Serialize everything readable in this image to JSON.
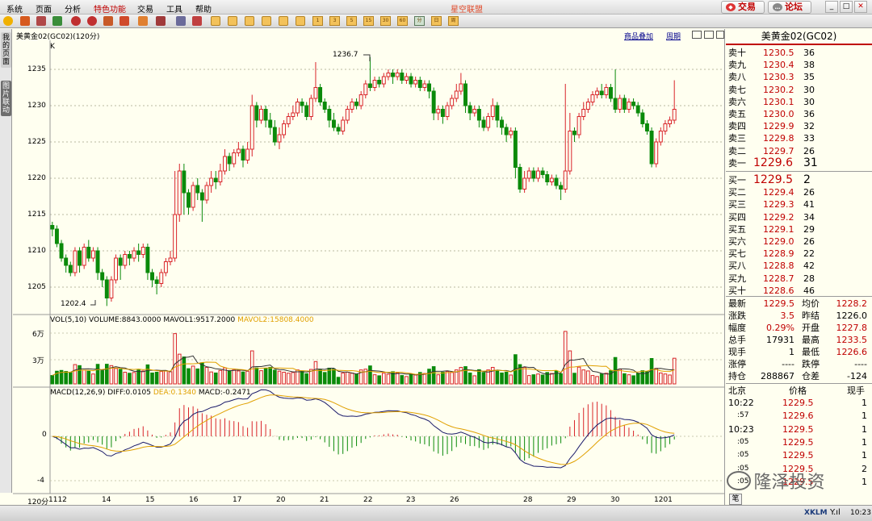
{
  "menu": {
    "items": [
      "系统",
      "页面",
      "分析",
      "特色功能",
      "交易",
      "工具",
      "帮助"
    ],
    "title": "星空联盟",
    "trade_btn": "交易",
    "forum_btn": "论坛"
  },
  "toolbar": {
    "periods": [
      "1",
      "3",
      "5",
      "15",
      "30",
      "60",
      "分",
      "日",
      "周"
    ]
  },
  "sidebar": {
    "tab1": "我的页面",
    "tab2": "图片联动"
  },
  "chart": {
    "header": "美黄金02(GC02)(120分)",
    "k_label": "K",
    "link_overlay": "商品叠加",
    "link_period": "周期",
    "price_ticks": [
      "1235",
      "1230",
      "1225",
      "1220",
      "1215",
      "1210",
      "1205"
    ],
    "high_label": "1236.7",
    "low_label": "1202.4",
    "vol_header": {
      "name": "VOL(5,10)",
      "volume": "VOLUME:8843.0000",
      "mavol1": "MAVOL1:9517.2000",
      "mavol2": "MAVOL2:15808.4000"
    },
    "vol_ticks": [
      "6万",
      "3万"
    ],
    "macd_header": {
      "name": "MACD(12,26,9)",
      "diff": "DIFF:0.0105",
      "dea": "DEA:0.1340",
      "macd": "MACD:-0.2471"
    },
    "macd_ticks": [
      "0",
      "-4"
    ],
    "x_axis": {
      "period": "120分",
      "labels": [
        "1112",
        "14",
        "15",
        "16",
        "17",
        "20",
        "21",
        "22",
        "23",
        "26",
        "28",
        "29",
        "30",
        "1201"
      ]
    }
  },
  "chart_data": {
    "type": "candlestick",
    "timeframe": "120分",
    "ylim": [
      1200,
      1238
    ],
    "y_ticks": [
      1205,
      1210,
      1215,
      1220,
      1225,
      1230,
      1235
    ],
    "high_marker": 1236.7,
    "low_marker": 1202.4,
    "candles": [
      [
        1213.5,
        1213,
        1214,
        1212
      ],
      [
        1213,
        1211,
        1213.5,
        1210.5
      ],
      [
        1211,
        1209,
        1211.5,
        1208.5
      ],
      [
        1209,
        1208,
        1209.5,
        1207
      ],
      [
        1208,
        1207,
        1208.5,
        1206.5
      ],
      [
        1207,
        1210,
        1210.5,
        1206.5
      ],
      [
        1210,
        1208,
        1210.5,
        1207
      ],
      [
        1208,
        1210.5,
        1211,
        1207.5
      ],
      [
        1210.5,
        1209,
        1211.5,
        1208.5
      ],
      [
        1209,
        1210,
        1210.5,
        1208.5
      ],
      [
        1210,
        1207,
        1210.5,
        1206
      ],
      [
        1207,
        1206,
        1207.5,
        1205
      ],
      [
        1206,
        1203.5,
        1206.5,
        1202.4
      ],
      [
        1203.5,
        1206,
        1206.5,
        1203
      ],
      [
        1206,
        1209,
        1209.5,
        1205.5
      ],
      [
        1209,
        1208,
        1209.5,
        1206
      ],
      [
        1208,
        1209.5,
        1210,
        1207.5
      ],
      [
        1209.5,
        1209,
        1210,
        1208
      ],
      [
        1209,
        1210,
        1210.5,
        1208.5
      ],
      [
        1210,
        1209.5,
        1211,
        1208.5
      ],
      [
        1209.5,
        1210.5,
        1211,
        1209
      ],
      [
        1210.5,
        1207,
        1211,
        1206
      ],
      [
        1207,
        1206,
        1207.5,
        1205
      ],
      [
        1206,
        1205.5,
        1206.5,
        1204
      ],
      [
        1205.5,
        1207,
        1207.5,
        1205
      ],
      [
        1207,
        1208.5,
        1209,
        1206.5
      ],
      [
        1208.5,
        1209,
        1210,
        1208
      ],
      [
        1209,
        1215,
        1221,
        1208.5
      ],
      [
        1215,
        1221,
        1222,
        1214
      ],
      [
        1221,
        1218,
        1222,
        1215
      ],
      [
        1218,
        1216,
        1218.5,
        1215
      ],
      [
        1216,
        1219,
        1219.5,
        1215.5
      ],
      [
        1219,
        1218,
        1220,
        1217
      ],
      [
        1218,
        1217,
        1218.5,
        1214
      ],
      [
        1217,
        1219,
        1219.5,
        1216.5
      ],
      [
        1219,
        1220,
        1221,
        1218
      ],
      [
        1220,
        1219.5,
        1221,
        1218.5
      ],
      [
        1219.5,
        1221,
        1222,
        1219
      ],
      [
        1221,
        1223,
        1224,
        1220.5
      ],
      [
        1223,
        1222,
        1223.5,
        1221
      ],
      [
        1222,
        1223.5,
        1224,
        1221.5
      ],
      [
        1223.5,
        1224,
        1225,
        1223
      ],
      [
        1224,
        1222.5,
        1224.5,
        1221.5
      ],
      [
        1222.5,
        1224,
        1225,
        1222
      ],
      [
        1224,
        1230,
        1231.5,
        1223
      ],
      [
        1230,
        1228,
        1230.5,
        1227
      ],
      [
        1228,
        1229.5,
        1230,
        1227.5
      ],
      [
        1229.5,
        1228,
        1230,
        1227
      ],
      [
        1228,
        1227,
        1229,
        1226
      ],
      [
        1227,
        1225,
        1228,
        1224.5
      ],
      [
        1225,
        1226,
        1227,
        1224
      ],
      [
        1226,
        1227.5,
        1228,
        1225.5
      ],
      [
        1227.5,
        1228.5,
        1229,
        1227
      ],
      [
        1228.5,
        1229,
        1230,
        1228
      ],
      [
        1229,
        1230.5,
        1231,
        1228.5
      ],
      [
        1230.5,
        1230,
        1231,
        1229
      ],
      [
        1230,
        1228.5,
        1230.5,
        1228
      ],
      [
        1228.5,
        1231,
        1231.5,
        1228
      ],
      [
        1231,
        1232.5,
        1236,
        1230.5
      ],
      [
        1232.5,
        1230.5,
        1233,
        1230
      ],
      [
        1230.5,
        1229.5,
        1231,
        1229
      ],
      [
        1229.5,
        1228,
        1230,
        1227
      ],
      [
        1228,
        1227,
        1229,
        1226.5
      ],
      [
        1227,
        1226.5,
        1227.5,
        1226
      ],
      [
        1226.5,
        1228,
        1228.5,
        1226
      ],
      [
        1228,
        1229.5,
        1230,
        1227.5
      ],
      [
        1229.5,
        1230.5,
        1231,
        1229
      ],
      [
        1230.5,
        1230,
        1231,
        1229.5
      ],
      [
        1230,
        1231.5,
        1232,
        1229.5
      ],
      [
        1231.5,
        1233,
        1233.5,
        1231
      ],
      [
        1233,
        1232.5,
        1236.7,
        1232
      ],
      [
        1232.5,
        1233.5,
        1234,
        1232
      ],
      [
        1233.5,
        1233,
        1234,
        1232.5
      ],
      [
        1233,
        1234,
        1234.5,
        1232.5
      ],
      [
        1234,
        1234.5,
        1235,
        1233.5
      ],
      [
        1234.5,
        1234,
        1235,
        1233
      ],
      [
        1234,
        1234.5,
        1235,
        1233.5
      ],
      [
        1234.5,
        1233.5,
        1235,
        1233
      ],
      [
        1233.5,
        1234,
        1234.5,
        1233
      ],
      [
        1234,
        1233,
        1234.5,
        1232.5
      ],
      [
        1233,
        1233.5,
        1234,
        1232.5
      ],
      [
        1233.5,
        1232.5,
        1234,
        1232
      ],
      [
        1232.5,
        1233,
        1233.5,
        1232
      ],
      [
        1233,
        1232,
        1233.5,
        1231
      ],
      [
        1232,
        1229,
        1232.5,
        1228
      ],
      [
        1229,
        1229.5,
        1230,
        1228
      ],
      [
        1229.5,
        1228.5,
        1230,
        1227.5
      ],
      [
        1228.5,
        1230,
        1230.5,
        1228
      ],
      [
        1230,
        1231,
        1231.5,
        1229.5
      ],
      [
        1231,
        1232,
        1233,
        1230.5
      ],
      [
        1232,
        1233,
        1234.5,
        1231.5
      ],
      [
        1233,
        1230,
        1233.5,
        1229
      ],
      [
        1230,
        1229,
        1230.5,
        1228
      ],
      [
        1229,
        1229.5,
        1230,
        1228.5
      ],
      [
        1229.5,
        1228,
        1230,
        1227
      ],
      [
        1228,
        1227,
        1228.5,
        1226.5
      ],
      [
        1227,
        1228.5,
        1229,
        1226.5
      ],
      [
        1228.5,
        1230,
        1231,
        1228
      ],
      [
        1230,
        1228,
        1230.5,
        1227
      ],
      [
        1228,
        1227,
        1228.5,
        1226
      ],
      [
        1227,
        1226,
        1227.5,
        1225
      ],
      [
        1226,
        1226.5,
        1227,
        1225.5
      ],
      [
        1226.5,
        1221.5,
        1227,
        1220
      ],
      [
        1221.5,
        1218.5,
        1222,
        1218
      ],
      [
        1218.5,
        1220,
        1221,
        1218
      ],
      [
        1220,
        1221,
        1221.5,
        1219.5
      ],
      [
        1221,
        1220,
        1221.5,
        1219.5
      ],
      [
        1220,
        1221,
        1221.5,
        1219.5
      ],
      [
        1221,
        1220.5,
        1221.5,
        1220
      ],
      [
        1220.5,
        1219.5,
        1221,
        1219
      ],
      [
        1219.5,
        1220,
        1220.5,
        1219
      ],
      [
        1220,
        1219,
        1220.5,
        1218.5
      ],
      [
        1219,
        1218.5,
        1219.5,
        1217
      ],
      [
        1218.5,
        1221,
        1233,
        1218
      ],
      [
        1221,
        1226.5,
        1229,
        1220.5
      ],
      [
        1226.5,
        1226,
        1227,
        1225
      ],
      [
        1226,
        1228.5,
        1229,
        1225.5
      ],
      [
        1228.5,
        1229.5,
        1230.5,
        1228
      ],
      [
        1229.5,
        1230.5,
        1231,
        1229
      ],
      [
        1230.5,
        1231.5,
        1232,
        1230
      ],
      [
        1231.5,
        1232,
        1232.5,
        1231
      ],
      [
        1232,
        1231.5,
        1233,
        1231
      ],
      [
        1231.5,
        1232.5,
        1233,
        1231
      ],
      [
        1232.5,
        1231,
        1233,
        1230.5
      ],
      [
        1231,
        1229.5,
        1235,
        1229
      ],
      [
        1229.5,
        1231,
        1231.5,
        1229
      ],
      [
        1231,
        1229.5,
        1231.5,
        1229
      ],
      [
        1229.5,
        1230.5,
        1231,
        1229
      ],
      [
        1230.5,
        1230,
        1231,
        1229.5
      ],
      [
        1230,
        1229,
        1230.5,
        1228.5
      ],
      [
        1229,
        1227.5,
        1229.5,
        1227
      ],
      [
        1227.5,
        1226.5,
        1228,
        1226
      ],
      [
        1226.5,
        1222,
        1227,
        1221.5
      ],
      [
        1222,
        1225,
        1225.5,
        1221.5
      ],
      [
        1225,
        1226.5,
        1227,
        1224.5
      ],
      [
        1226.5,
        1227.5,
        1228,
        1226
      ],
      [
        1227.5,
        1228,
        1228.5,
        1227
      ],
      [
        1228,
        1229.5,
        1233.5,
        1227.5
      ]
    ],
    "volume_ticks": [
      "6万",
      "3万"
    ],
    "volume": {
      "value": 8843.0,
      "mavol1": 9517.2,
      "mavol2": 15808.4
    },
    "macd": {
      "params": "12,26,9",
      "diff": 0.0105,
      "dea": 0.134,
      "macd": -0.2471,
      "ticks": [
        0,
        -4
      ]
    },
    "x_labels": [
      "1112",
      "14",
      "15",
      "16",
      "17",
      "20",
      "21",
      "22",
      "23",
      "26",
      "28",
      "29",
      "30",
      "1201"
    ]
  },
  "panel": {
    "title": "美黄金02(GC02)",
    "asks": [
      {
        "label": "卖十",
        "price": "1230.5",
        "vol": "36"
      },
      {
        "label": "卖九",
        "price": "1230.4",
        "vol": "38"
      },
      {
        "label": "卖八",
        "price": "1230.3",
        "vol": "35"
      },
      {
        "label": "卖七",
        "price": "1230.2",
        "vol": "30"
      },
      {
        "label": "卖六",
        "price": "1230.1",
        "vol": "30"
      },
      {
        "label": "卖五",
        "price": "1230.0",
        "vol": "36"
      },
      {
        "label": "卖四",
        "price": "1229.9",
        "vol": "32"
      },
      {
        "label": "卖三",
        "price": "1229.8",
        "vol": "33"
      },
      {
        "label": "卖二",
        "price": "1229.7",
        "vol": "26"
      },
      {
        "label": "卖一",
        "price": "1229.6",
        "vol": "31"
      }
    ],
    "bids": [
      {
        "label": "买一",
        "price": "1229.5",
        "vol": "2"
      },
      {
        "label": "买二",
        "price": "1229.4",
        "vol": "26"
      },
      {
        "label": "买三",
        "price": "1229.3",
        "vol": "41"
      },
      {
        "label": "买四",
        "price": "1229.2",
        "vol": "34"
      },
      {
        "label": "买五",
        "price": "1229.1",
        "vol": "29"
      },
      {
        "label": "买六",
        "price": "1229.0",
        "vol": "26"
      },
      {
        "label": "买七",
        "price": "1228.9",
        "vol": "22"
      },
      {
        "label": "买八",
        "price": "1228.8",
        "vol": "42"
      },
      {
        "label": "买九",
        "price": "1228.7",
        "vol": "28"
      },
      {
        "label": "买十",
        "price": "1228.6",
        "vol": "46"
      }
    ],
    "stats": [
      {
        "l1": "最新",
        "v1": "1229.5",
        "l2": "均价",
        "v2": "1228.2"
      },
      {
        "l1": "涨跌",
        "v1": "3.5",
        "l2": "昨结",
        "v2": "1226.0"
      },
      {
        "l1": "幅度",
        "v1": "0.29%",
        "l2": "开盘",
        "v2": "1227.8"
      },
      {
        "l1": "总手",
        "v1": "17931",
        "l2": "最高",
        "v2": "1233.5"
      },
      {
        "l1": "现手",
        "v1": "1",
        "l2": "最低",
        "v2": "1226.6"
      },
      {
        "l1": "涨停",
        "v1": "----",
        "l2": "跌停",
        "v2": "----"
      },
      {
        "l1": "持仓",
        "v1": "288867",
        "l2": "仓差",
        "v2": "-124"
      }
    ],
    "ticks_header": {
      "place": "北京",
      "price": "价格",
      "vol": "现手"
    },
    "ticks": [
      {
        "time": "10:22",
        "price": "1229.5",
        "vol": "1"
      },
      {
        "time": ":57",
        "price": "1229.6",
        "vol": "1"
      },
      {
        "time": "10:23",
        "price": "1229.5",
        "vol": "1"
      },
      {
        "time": ":05",
        "price": "1229.5",
        "vol": "1"
      },
      {
        "time": ":05",
        "price": "1229.5",
        "vol": "1"
      },
      {
        "time": ":05",
        "price": "1229.5",
        "vol": "2"
      },
      {
        "time": ":05",
        "price": "1229.5",
        "vol": "1"
      }
    ],
    "bottom_tab": "笔"
  },
  "watermark": "隆泽投资",
  "status": {
    "brand": "XKLM",
    "time": "10:23"
  },
  "colors": {
    "up": "#d9242a",
    "down": "#0a8a0a",
    "accent": "#c00000"
  }
}
